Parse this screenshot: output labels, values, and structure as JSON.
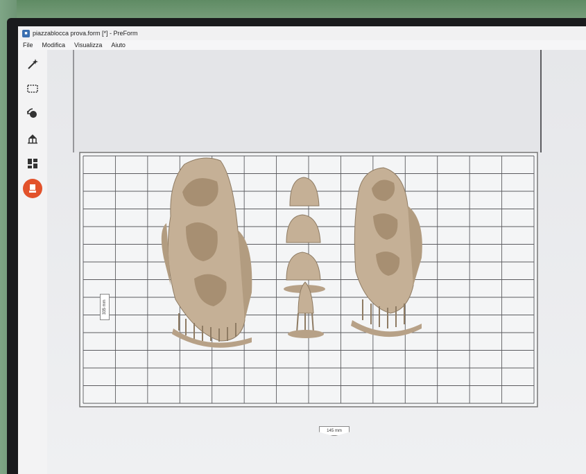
{
  "window": {
    "title": "piazzablocca prova.form [*] - PreForm",
    "app_icon": "preform-app-icon"
  },
  "menubar": {
    "items": [
      "File",
      "Modifica",
      "Visualizza",
      "Aiuto"
    ]
  },
  "toolbar": {
    "tools": [
      {
        "name": "magic-wand-icon",
        "active": false
      },
      {
        "name": "selection-box-icon",
        "active": false
      },
      {
        "name": "orientation-icon",
        "active": false
      },
      {
        "name": "supports-icon",
        "active": false
      },
      {
        "name": "layout-icon",
        "active": false
      },
      {
        "name": "print-job-icon",
        "active": true
      }
    ],
    "active_color": "#e2522b"
  },
  "build_platform": {
    "side_dimension_label": "335 mm",
    "bottom_dimension_label": "145 mm",
    "models": [
      "dental-arch-model-left",
      "small-die-models-center",
      "dental-arch-model-right"
    ],
    "model_color": "#c5b096"
  }
}
